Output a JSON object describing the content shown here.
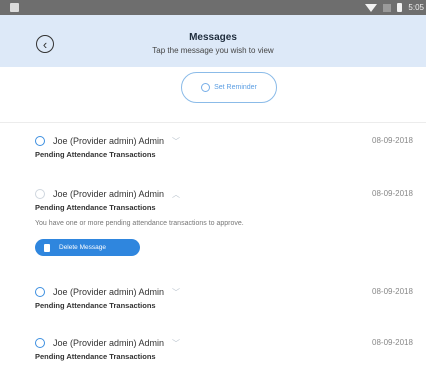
{
  "status_bar": {
    "time": "5:05"
  },
  "header": {
    "title": "Messages",
    "subtitle": "Tap the message you wish to view"
  },
  "reminder_button": {
    "label": "Set Reminder"
  },
  "messages": [
    {
      "sender": "Joe (Provider admin) Admin",
      "date": "08-09-2018",
      "subject": "Pending Attendance Transactions",
      "expanded": false,
      "unread": true
    },
    {
      "sender": "Joe (Provider admin) Admin",
      "date": "08-09-2018",
      "subject": "Pending Attendance Transactions",
      "body": "You have one or more pending attendance transactions to approve.",
      "expanded": true,
      "unread": false,
      "delete_label": "Delete Message"
    },
    {
      "sender": "Joe (Provider admin) Admin",
      "date": "08-09-2018",
      "subject": "Pending Attendance Transactions",
      "expanded": false,
      "unread": true
    },
    {
      "sender": "Joe (Provider admin) Admin",
      "date": "08-09-2018",
      "subject": "Pending Attendance Transactions",
      "expanded": false,
      "unread": true
    }
  ],
  "colors": {
    "header_bg": "#dde9f8",
    "accent": "#2f86de",
    "status_bar": "#6e6e6e"
  }
}
